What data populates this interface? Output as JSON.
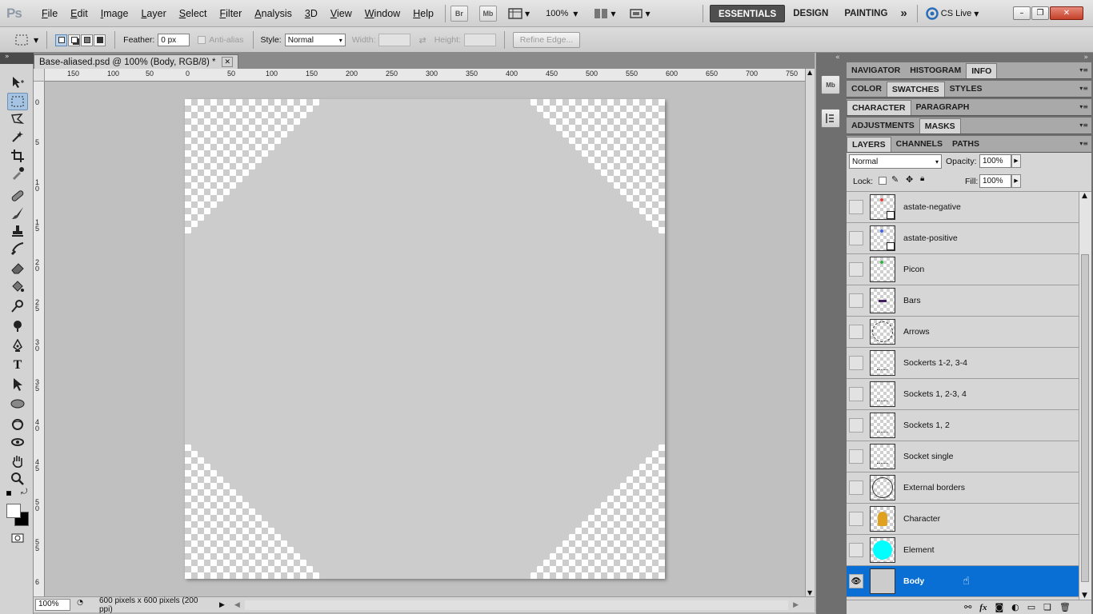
{
  "app": {
    "logo": "Ps"
  },
  "menubar": {
    "items": [
      "File",
      "Edit",
      "Image",
      "Layer",
      "Select",
      "Filter",
      "Analysis",
      "3D",
      "View",
      "Window",
      "Help"
    ],
    "bridge_label": "Br",
    "minibridge_label": "Mb",
    "zoom": "100%",
    "workspaces": [
      "ESSENTIALS",
      "DESIGN",
      "PAINTING"
    ],
    "more_label": "»",
    "cs_live": "CS Live",
    "window_controls": {
      "minimize": "–",
      "restore": "❐",
      "close": "✕"
    }
  },
  "options": {
    "feather_label": "Feather:",
    "feather_value": "0 px",
    "antialias_label": "Anti-alias",
    "style_label": "Style:",
    "style_value": "Normal",
    "width_label": "Width:",
    "height_label": "Height:",
    "refine_edge": "Refine Edge..."
  },
  "document": {
    "tab_title": "Base-aliased.psd @ 100% (Body, RGB/8) *",
    "close": "✕",
    "ruler_top_labels": [
      "150",
      "100",
      "50",
      "0",
      "50",
      "100",
      "150",
      "200",
      "250",
      "300",
      "350",
      "400",
      "450",
      "500",
      "550",
      "600",
      "650",
      "700",
      "750"
    ],
    "ruler_left_labels": [
      "0",
      "5",
      "1 0",
      "1 5",
      "2 0",
      "2 5",
      "3 0",
      "3 5",
      "4 0",
      "4 5",
      "5 0",
      "5 5",
      "6"
    ],
    "zoom": "100%",
    "status": "600 pixels x 600 pixels (200 ppi)"
  },
  "panels": {
    "group1": [
      "NAVIGATOR",
      "HISTOGRAM",
      "INFO"
    ],
    "group1_active": "INFO",
    "group2": [
      "COLOR",
      "SWATCHES",
      "STYLES"
    ],
    "group2_active": "SWATCHES",
    "group3": [
      "CHARACTER",
      "PARAGRAPH"
    ],
    "group3_active": "CHARACTER",
    "group4": [
      "ADJUSTMENTS",
      "MASKS"
    ],
    "group4_active": "MASKS",
    "group5": [
      "LAYERS",
      "CHANNELS",
      "PATHS"
    ],
    "group5_active": "LAYERS",
    "dock_mb": "Mb"
  },
  "layers": {
    "blend_mode": "Normal",
    "opacity_label": "Opacity:",
    "opacity_value": "100%",
    "lock_label": "Lock:",
    "fill_label": "Fill:",
    "fill_value": "100%",
    "items": [
      {
        "name": "astate-negative",
        "visible": false,
        "selected": false
      },
      {
        "name": "astate-positive",
        "visible": false,
        "selected": false
      },
      {
        "name": "Picon",
        "visible": false,
        "selected": false
      },
      {
        "name": "Bars",
        "visible": false,
        "selected": false
      },
      {
        "name": "Arrows",
        "visible": false,
        "selected": false
      },
      {
        "name": "Sockerts 1-2, 3-4",
        "visible": false,
        "selected": false
      },
      {
        "name": "Sockets 1, 2-3, 4",
        "visible": false,
        "selected": false
      },
      {
        "name": "Sockets 1, 2",
        "visible": false,
        "selected": false
      },
      {
        "name": "Socket single",
        "visible": false,
        "selected": false
      },
      {
        "name": "External borders",
        "visible": false,
        "selected": false
      },
      {
        "name": "Character",
        "visible": false,
        "selected": false
      },
      {
        "name": "Element",
        "visible": false,
        "selected": false
      },
      {
        "name": "Body",
        "visible": true,
        "selected": true
      }
    ],
    "footer_icons": [
      "link-icon",
      "fx-icon",
      "mask-icon",
      "adjustment-icon",
      "group-icon",
      "new-layer-icon",
      "trash-icon"
    ]
  },
  "colors": {
    "selection_blue": "#0a6fd4",
    "body_gray": "#cccccc",
    "element_cyan": "#00ffff"
  }
}
